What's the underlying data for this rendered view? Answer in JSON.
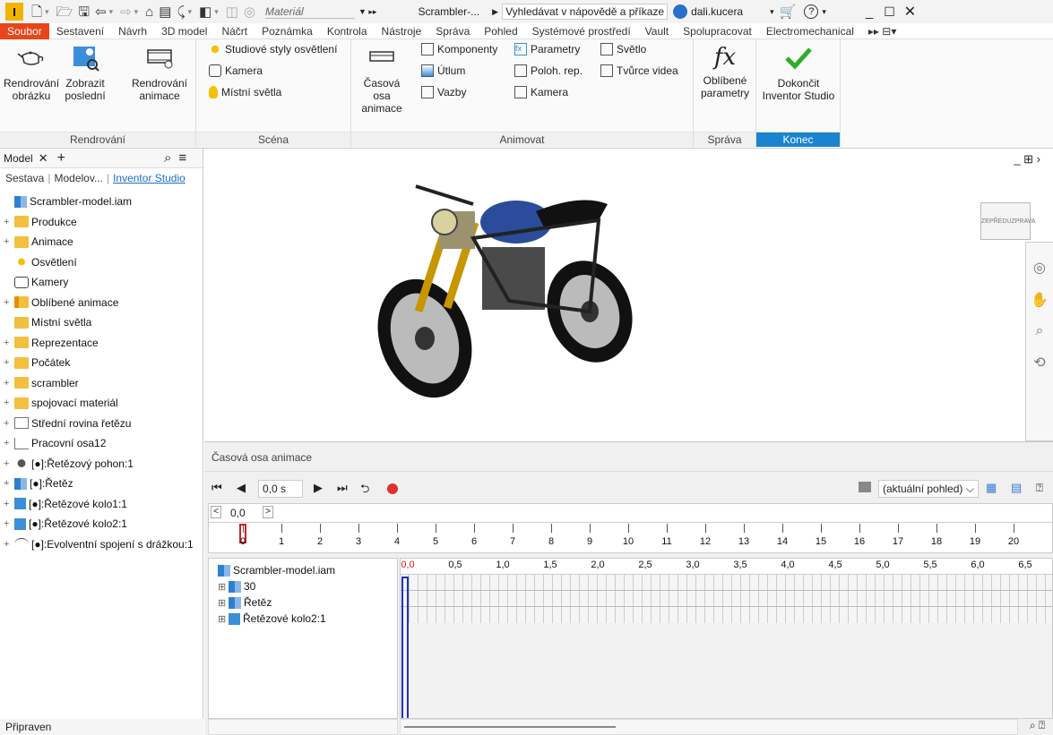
{
  "qat": {
    "logo": "I",
    "material": "Materiál",
    "doc_title": "Scrambler-...",
    "help_search": "Vyhledávat v nápovědě a příkaze",
    "user": "dali.kucera"
  },
  "menu": [
    "Soubor",
    "Sestavení",
    "Návrh",
    "3D model",
    "Náčrt",
    "Poznámka",
    "Kontrola",
    "Nástroje",
    "Správa",
    "Pohled",
    "Systémové prostředí",
    "Vault",
    "Spolupracovat",
    "Electromechanical"
  ],
  "ribbon": {
    "render": {
      "label": "Rendrování",
      "render_image": "Rendrování obrázku",
      "show_last": "Zobrazit poslední",
      "render_anim": "Rendrování animace"
    },
    "scene": {
      "label": "Scéna",
      "styles": "Studiové styly osvětlení",
      "camera": "Kamera",
      "local_lights": "Místní světla"
    },
    "animate": {
      "label": "Animovat",
      "timeline": "Časová osa animace",
      "components": "Komponenty",
      "fade": "Útlum",
      "constraints": "Vazby",
      "parameters": "Parametry",
      "pos_rep": "Poloh. rep.",
      "camera": "Kamera",
      "light": "Světlo",
      "video": "Tvůrce videa"
    },
    "manage": {
      "label": "Správa",
      "fav_params": "Oblíbené parametry"
    },
    "finish": {
      "label": "Konec",
      "finish": "Dokončit Inventor Studio"
    }
  },
  "browser": {
    "tab": "Model",
    "sub": {
      "a": "Sestava",
      "b": "Modelov...",
      "c": "Inventor Studio"
    },
    "items": [
      {
        "label": "Scrambler-model.iam",
        "pm": "",
        "icon": "assembly-icon"
      },
      {
        "label": "Produkce",
        "pm": "+",
        "icon": "folder-icon"
      },
      {
        "label": "Animace",
        "pm": "+",
        "icon": "folder-icon"
      },
      {
        "label": "Osvětlení",
        "pm": "",
        "icon": "sun-icon"
      },
      {
        "label": "Kamery",
        "pm": "",
        "icon": "camera-icon"
      },
      {
        "label": "Oblíbené animace",
        "pm": "+",
        "icon": "star-folder-icon"
      },
      {
        "label": "Místní světla",
        "pm": "",
        "icon": "folder-icon"
      },
      {
        "label": "Reprezentace",
        "pm": "+",
        "icon": "folder-icon"
      },
      {
        "label": "Počátek",
        "pm": "+",
        "icon": "folder-icon"
      },
      {
        "label": "scrambler",
        "pm": "+",
        "icon": "folder-icon"
      },
      {
        "label": "spojovací materiál",
        "pm": "+",
        "icon": "folder-icon"
      },
      {
        "label": "Střední rovina řetězu",
        "pm": "+",
        "icon": "plane-icon"
      },
      {
        "label": "Pracovní osa12",
        "pm": "+",
        "icon": "axis-icon"
      },
      {
        "label": "[●]:Řetězový pohon:1",
        "pm": "+",
        "icon": "chain-drive-icon"
      },
      {
        "label": "[●]:Řetěz",
        "pm": "+",
        "icon": "assembly-icon"
      },
      {
        "label": "[●]:Řetězové kolo1:1",
        "pm": "+",
        "icon": "part-icon"
      },
      {
        "label": "[●]:Řetězové kolo2:1",
        "pm": "+",
        "icon": "part-icon"
      },
      {
        "label": "[●]:Evolventní spojení s drážkou:1",
        "pm": "+",
        "icon": "spline-icon"
      }
    ],
    "status": "Připraven"
  },
  "viewcube": {
    "front": "ZEPŘEDU",
    "right": "ZPRAVA"
  },
  "timeline": {
    "title": "Časová osa animace",
    "time_value": "0,0 s",
    "view_select": "(aktuální pohled)",
    "slider_value": "0,0",
    "slider_max_label": ">",
    "ruler_ticks": [
      "0",
      "1",
      "2",
      "3",
      "4",
      "5",
      "6",
      "7",
      "8",
      "9",
      "10",
      "11",
      "12",
      "13",
      "14",
      "15",
      "16",
      "17",
      "18",
      "19",
      "20"
    ],
    "track_ticks": [
      "0,0",
      "0,5",
      "1,0",
      "1,5",
      "2,0",
      "2,5",
      "3,0",
      "3,5",
      "4,0",
      "4,5",
      "5,0",
      "5,5",
      "6,0",
      "6,5"
    ],
    "tree": [
      {
        "label": "Scrambler-model.iam",
        "icon": "assembly-icon"
      },
      {
        "label": "30",
        "icon": "assembly-icon"
      },
      {
        "label": "Řetěz",
        "icon": "assembly-icon"
      },
      {
        "label": "Řetězové kolo2:1",
        "icon": "part-icon"
      }
    ]
  }
}
